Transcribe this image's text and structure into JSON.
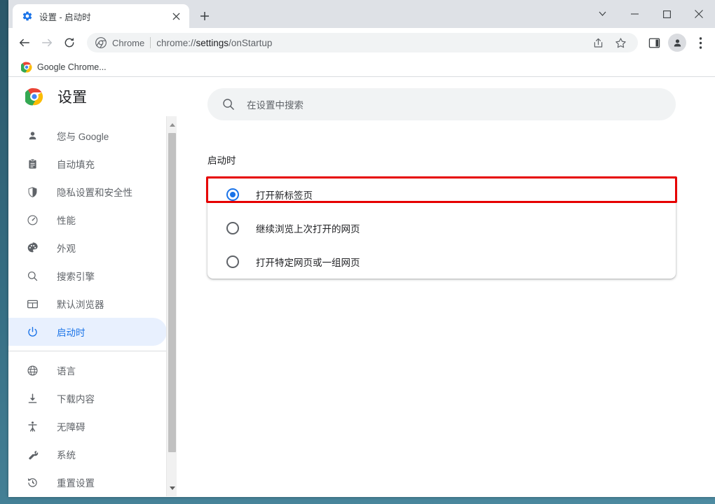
{
  "window": {
    "controls": [
      {
        "name": "tab-search-button",
        "icon": "chevron-down-icon",
        "label": "⌄"
      },
      {
        "name": "minimize-button",
        "icon": "minimize-icon",
        "label": "—"
      },
      {
        "name": "maximize-button",
        "icon": "maximize-icon",
        "label": "□"
      },
      {
        "name": "close-button",
        "icon": "close-icon",
        "label": "✕"
      }
    ]
  },
  "tabstrip": {
    "tab": {
      "title": "设置 - 启动时",
      "favicon": "gear-icon",
      "close_label": "✕"
    },
    "new_tab_label": "+"
  },
  "toolbar": {
    "back_label": "←",
    "forward_label": "→",
    "reload_label": "⟳",
    "omnibox": {
      "brand_icon": "chrome-icon",
      "scheme_label": "Chrome",
      "url_prefix": "chrome://",
      "url_strong": "settings",
      "url_suffix": "/onStartup"
    },
    "actions": [
      {
        "name": "share-button",
        "icon": "share-icon"
      },
      {
        "name": "bookmark-button",
        "icon": "star-icon"
      }
    ],
    "side_panel": {
      "name": "side-panel-button",
      "icon": "side-panel-icon"
    },
    "profile": {
      "name": "profile-avatar-button",
      "icon": "person-icon"
    },
    "menu": {
      "name": "chrome-menu-button",
      "icon": "three-dot-menu-icon"
    }
  },
  "bookmarks_bar": {
    "items": [
      {
        "label": "Google Chrome...",
        "favicon": "chrome-icon"
      }
    ]
  },
  "sidebar": {
    "logo": "chrome-logo-icon",
    "title": "设置",
    "groups": [
      {
        "items": [
          {
            "label": "您与 Google",
            "icon": "person-icon",
            "active": false
          },
          {
            "label": "自动填充",
            "icon": "clipboard-icon",
            "active": false
          },
          {
            "label": "隐私设置和安全性",
            "icon": "shield-icon",
            "active": false
          },
          {
            "label": "性能",
            "icon": "speedometer-icon",
            "active": false
          },
          {
            "label": "外观",
            "icon": "palette-icon",
            "active": false
          },
          {
            "label": "搜索引擎",
            "icon": "search-icon",
            "active": false
          },
          {
            "label": "默认浏览器",
            "icon": "browser-window-icon",
            "active": false
          },
          {
            "label": "启动时",
            "icon": "power-icon",
            "active": true
          }
        ]
      },
      {
        "items": [
          {
            "label": "语言",
            "icon": "globe-icon",
            "active": false
          },
          {
            "label": "下载内容",
            "icon": "download-icon",
            "active": false
          },
          {
            "label": "无障碍",
            "icon": "accessibility-icon",
            "active": false
          },
          {
            "label": "系统",
            "icon": "wrench-icon",
            "active": false
          },
          {
            "label": "重置设置",
            "icon": "history-restore-icon",
            "active": false
          }
        ]
      }
    ],
    "scrollbar": {
      "up_arrow": "▲",
      "down_arrow": "▼"
    }
  },
  "main": {
    "search": {
      "icon": "search-icon",
      "placeholder": "在设置中搜索",
      "value": ""
    },
    "section_title": "启动时",
    "startup_options": [
      {
        "label": "打开新标签页",
        "selected": true,
        "highlighted": true
      },
      {
        "label": "继续浏览上次打开的网页",
        "selected": false,
        "highlighted": false
      },
      {
        "label": "打开特定网页或一组网页",
        "selected": false,
        "highlighted": false
      }
    ]
  },
  "colors": {
    "accent_blue": "#1a73e8",
    "active_pill": "#e8f0fe",
    "tabstrip_bg": "#dee1e6",
    "highlight_red": "#e60000",
    "text_primary": "#202124",
    "text_secondary": "#5f6368",
    "desktop_teal": "#356d82"
  }
}
